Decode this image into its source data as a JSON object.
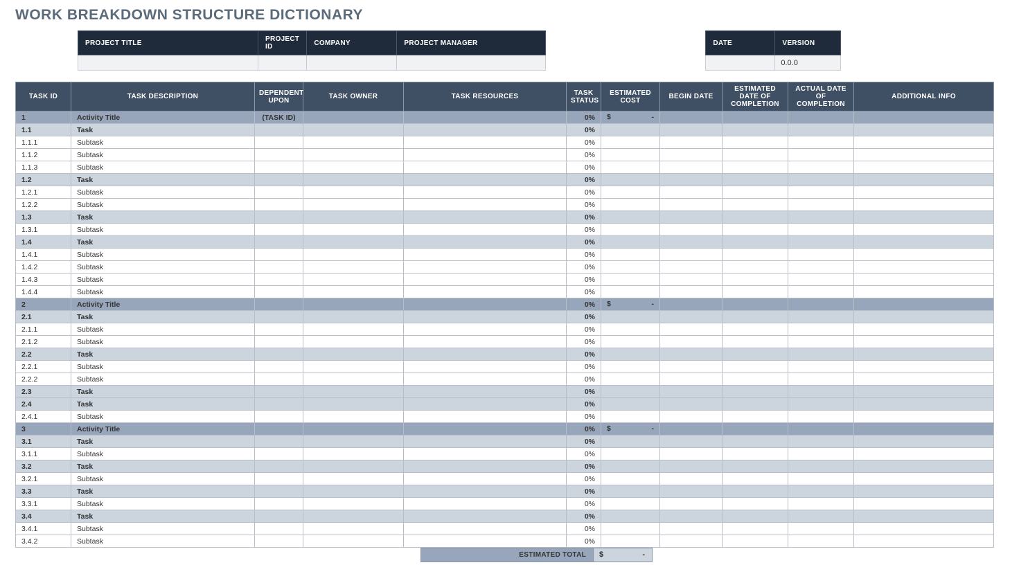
{
  "title": "WORK BREAKDOWN STRUCTURE DICTIONARY",
  "meta1": {
    "headers": {
      "project_title": "PROJECT TITLE",
      "project_id": "PROJECT ID",
      "company": "COMPANY",
      "project_manager": "PROJECT MANAGER"
    },
    "values": {
      "project_title": "",
      "project_id": "",
      "company": "",
      "project_manager": ""
    }
  },
  "meta2": {
    "headers": {
      "date": "DATE",
      "version": "VERSION"
    },
    "values": {
      "date": "",
      "version": "0.0.0"
    }
  },
  "columns": {
    "task_id": "TASK ID",
    "description": "TASK DESCRIPTION",
    "dependent_upon": "DEPENDENT UPON",
    "task_owner": "TASK OWNER",
    "task_resources": "TASK RESOURCES",
    "task_status": "TASK STATUS",
    "estimated_cost": "ESTIMATED COST",
    "begin_date": "BEGIN DATE",
    "est_completion": "ESTIMATED DATE OF COMPLETION",
    "act_completion": "ACTUAL DATE OF COMPLETION",
    "additional_info": "ADDITIONAL INFO"
  },
  "rows": [
    {
      "level": "activity",
      "task_id": "1",
      "description": "Activity Title",
      "dependent_upon": "(TASK ID)",
      "status": "0%",
      "cost": "$ -"
    },
    {
      "level": "task",
      "task_id": "1.1",
      "description": "Task",
      "status": "0%"
    },
    {
      "level": "subtask",
      "task_id": "1.1.1",
      "description": "Subtask",
      "status": "0%"
    },
    {
      "level": "subtask",
      "task_id": "1.1.2",
      "description": "Subtask",
      "status": "0%"
    },
    {
      "level": "subtask",
      "task_id": "1.1.3",
      "description": "Subtask",
      "status": "0%"
    },
    {
      "level": "task",
      "task_id": "1.2",
      "description": "Task",
      "status": "0%"
    },
    {
      "level": "subtask",
      "task_id": "1.2.1",
      "description": "Subtask",
      "status": "0%"
    },
    {
      "level": "subtask",
      "task_id": "1.2.2",
      "description": "Subtask",
      "status": "0%"
    },
    {
      "level": "task",
      "task_id": "1.3",
      "description": "Task",
      "status": "0%"
    },
    {
      "level": "subtask",
      "task_id": "1.3.1",
      "description": "Subtask",
      "status": "0%"
    },
    {
      "level": "task",
      "task_id": "1.4",
      "description": "Task",
      "status": "0%"
    },
    {
      "level": "subtask",
      "task_id": "1.4.1",
      "description": "Subtask",
      "status": "0%"
    },
    {
      "level": "subtask",
      "task_id": "1.4.2",
      "description": "Subtask",
      "status": "0%"
    },
    {
      "level": "subtask",
      "task_id": "1.4.3",
      "description": "Subtask",
      "status": "0%"
    },
    {
      "level": "subtask",
      "task_id": "1.4.4",
      "description": "Subtask",
      "status": "0%"
    },
    {
      "level": "activity",
      "task_id": "2",
      "description": "Activity Title",
      "status": "0%",
      "cost": "$ -"
    },
    {
      "level": "task",
      "task_id": "2.1",
      "description": "Task",
      "status": "0%"
    },
    {
      "level": "subtask",
      "task_id": "2.1.1",
      "description": "Subtask",
      "status": "0%"
    },
    {
      "level": "subtask",
      "task_id": "2.1.2",
      "description": "Subtask",
      "status": "0%"
    },
    {
      "level": "task",
      "task_id": "2.2",
      "description": "Task",
      "status": "0%"
    },
    {
      "level": "subtask",
      "task_id": "2.2.1",
      "description": "Subtask",
      "status": "0%"
    },
    {
      "level": "subtask",
      "task_id": "2.2.2",
      "description": "Subtask",
      "status": "0%"
    },
    {
      "level": "task",
      "task_id": "2.3",
      "description": "Task",
      "status": "0%"
    },
    {
      "level": "task",
      "task_id": "2.4",
      "description": "Task",
      "status": "0%"
    },
    {
      "level": "subtask",
      "task_id": "2.4.1",
      "description": "Subtask",
      "status": "0%"
    },
    {
      "level": "activity",
      "task_id": "3",
      "description": "Activity Title",
      "status": "0%",
      "cost": "$ -"
    },
    {
      "level": "task",
      "task_id": "3.1",
      "description": "Task",
      "status": "0%"
    },
    {
      "level": "subtask",
      "task_id": "3.1.1",
      "description": "Subtask",
      "status": "0%"
    },
    {
      "level": "task",
      "task_id": "3.2",
      "description": "Task",
      "status": "0%"
    },
    {
      "level": "subtask",
      "task_id": "3.2.1",
      "description": "Subtask",
      "status": "0%"
    },
    {
      "level": "task",
      "task_id": "3.3",
      "description": "Task",
      "status": "0%"
    },
    {
      "level": "subtask",
      "task_id": "3.3.1",
      "description": "Subtask",
      "status": "0%"
    },
    {
      "level": "task",
      "task_id": "3.4",
      "description": "Task",
      "status": "0%"
    },
    {
      "level": "subtask",
      "task_id": "3.4.1",
      "description": "Subtask",
      "status": "0%"
    },
    {
      "level": "subtask",
      "task_id": "3.4.2",
      "description": "Subtask",
      "status": "0%"
    }
  ],
  "total": {
    "label": "ESTIMATED TOTAL",
    "value": "$ -"
  }
}
